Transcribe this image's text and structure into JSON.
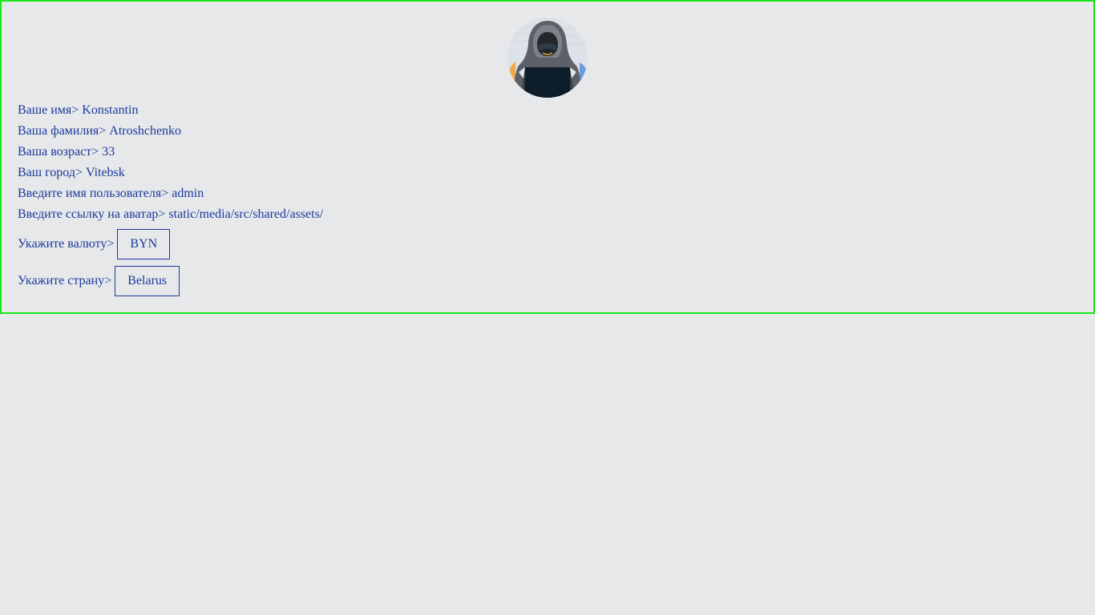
{
  "profile": {
    "fields": [
      {
        "label": "Ваше имя>",
        "value": "Konstantin"
      },
      {
        "label": "Ваша фамилия>",
        "value": "Atroshchenko"
      },
      {
        "label": "Ваша возраст>",
        "value": "33"
      },
      {
        "label": "Ваш город>",
        "value": "Vitebsk"
      },
      {
        "label": "Введите имя пользователя>",
        "value": "admin"
      },
      {
        "label": "Введите ссылку на аватар>",
        "value": "static/media/src/shared/assets/"
      }
    ],
    "currency": {
      "label": "Укажите валюту>",
      "value": "BYN"
    },
    "country": {
      "label": "Укажите страну>",
      "value": "Belarus"
    }
  },
  "colors": {
    "text": "#1a3a9c",
    "border": "#19e619",
    "background": "#e7e8ea"
  },
  "icons": {
    "avatar": "hooded-hacker-avatar"
  }
}
